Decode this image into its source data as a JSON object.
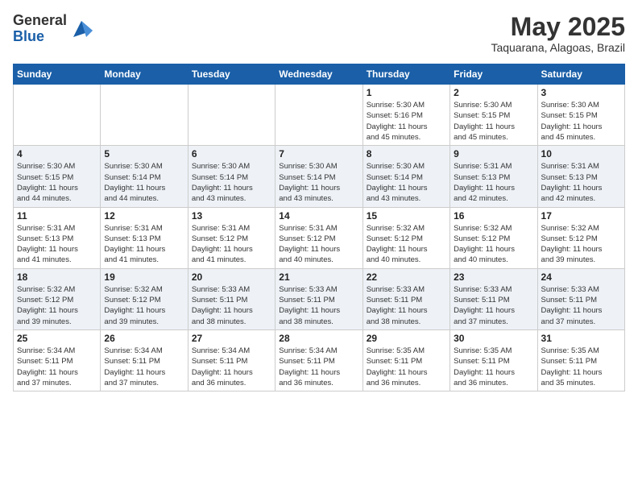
{
  "header": {
    "logo_general": "General",
    "logo_blue": "Blue",
    "month_title": "May 2025",
    "location": "Taquarana, Alagoas, Brazil"
  },
  "weekdays": [
    "Sunday",
    "Monday",
    "Tuesday",
    "Wednesday",
    "Thursday",
    "Friday",
    "Saturday"
  ],
  "weeks": [
    [
      {
        "day": "",
        "info": ""
      },
      {
        "day": "",
        "info": ""
      },
      {
        "day": "",
        "info": ""
      },
      {
        "day": "",
        "info": ""
      },
      {
        "day": "1",
        "info": "Sunrise: 5:30 AM\nSunset: 5:16 PM\nDaylight: 11 hours\nand 45 minutes."
      },
      {
        "day": "2",
        "info": "Sunrise: 5:30 AM\nSunset: 5:15 PM\nDaylight: 11 hours\nand 45 minutes."
      },
      {
        "day": "3",
        "info": "Sunrise: 5:30 AM\nSunset: 5:15 PM\nDaylight: 11 hours\nand 45 minutes."
      }
    ],
    [
      {
        "day": "4",
        "info": "Sunrise: 5:30 AM\nSunset: 5:15 PM\nDaylight: 11 hours\nand 44 minutes."
      },
      {
        "day": "5",
        "info": "Sunrise: 5:30 AM\nSunset: 5:14 PM\nDaylight: 11 hours\nand 44 minutes."
      },
      {
        "day": "6",
        "info": "Sunrise: 5:30 AM\nSunset: 5:14 PM\nDaylight: 11 hours\nand 43 minutes."
      },
      {
        "day": "7",
        "info": "Sunrise: 5:30 AM\nSunset: 5:14 PM\nDaylight: 11 hours\nand 43 minutes."
      },
      {
        "day": "8",
        "info": "Sunrise: 5:30 AM\nSunset: 5:14 PM\nDaylight: 11 hours\nand 43 minutes."
      },
      {
        "day": "9",
        "info": "Sunrise: 5:31 AM\nSunset: 5:13 PM\nDaylight: 11 hours\nand 42 minutes."
      },
      {
        "day": "10",
        "info": "Sunrise: 5:31 AM\nSunset: 5:13 PM\nDaylight: 11 hours\nand 42 minutes."
      }
    ],
    [
      {
        "day": "11",
        "info": "Sunrise: 5:31 AM\nSunset: 5:13 PM\nDaylight: 11 hours\nand 41 minutes."
      },
      {
        "day": "12",
        "info": "Sunrise: 5:31 AM\nSunset: 5:13 PM\nDaylight: 11 hours\nand 41 minutes."
      },
      {
        "day": "13",
        "info": "Sunrise: 5:31 AM\nSunset: 5:12 PM\nDaylight: 11 hours\nand 41 minutes."
      },
      {
        "day": "14",
        "info": "Sunrise: 5:31 AM\nSunset: 5:12 PM\nDaylight: 11 hours\nand 40 minutes."
      },
      {
        "day": "15",
        "info": "Sunrise: 5:32 AM\nSunset: 5:12 PM\nDaylight: 11 hours\nand 40 minutes."
      },
      {
        "day": "16",
        "info": "Sunrise: 5:32 AM\nSunset: 5:12 PM\nDaylight: 11 hours\nand 40 minutes."
      },
      {
        "day": "17",
        "info": "Sunrise: 5:32 AM\nSunset: 5:12 PM\nDaylight: 11 hours\nand 39 minutes."
      }
    ],
    [
      {
        "day": "18",
        "info": "Sunrise: 5:32 AM\nSunset: 5:12 PM\nDaylight: 11 hours\nand 39 minutes."
      },
      {
        "day": "19",
        "info": "Sunrise: 5:32 AM\nSunset: 5:12 PM\nDaylight: 11 hours\nand 39 minutes."
      },
      {
        "day": "20",
        "info": "Sunrise: 5:33 AM\nSunset: 5:11 PM\nDaylight: 11 hours\nand 38 minutes."
      },
      {
        "day": "21",
        "info": "Sunrise: 5:33 AM\nSunset: 5:11 PM\nDaylight: 11 hours\nand 38 minutes."
      },
      {
        "day": "22",
        "info": "Sunrise: 5:33 AM\nSunset: 5:11 PM\nDaylight: 11 hours\nand 38 minutes."
      },
      {
        "day": "23",
        "info": "Sunrise: 5:33 AM\nSunset: 5:11 PM\nDaylight: 11 hours\nand 37 minutes."
      },
      {
        "day": "24",
        "info": "Sunrise: 5:33 AM\nSunset: 5:11 PM\nDaylight: 11 hours\nand 37 minutes."
      }
    ],
    [
      {
        "day": "25",
        "info": "Sunrise: 5:34 AM\nSunset: 5:11 PM\nDaylight: 11 hours\nand 37 minutes."
      },
      {
        "day": "26",
        "info": "Sunrise: 5:34 AM\nSunset: 5:11 PM\nDaylight: 11 hours\nand 37 minutes."
      },
      {
        "day": "27",
        "info": "Sunrise: 5:34 AM\nSunset: 5:11 PM\nDaylight: 11 hours\nand 36 minutes."
      },
      {
        "day": "28",
        "info": "Sunrise: 5:34 AM\nSunset: 5:11 PM\nDaylight: 11 hours\nand 36 minutes."
      },
      {
        "day": "29",
        "info": "Sunrise: 5:35 AM\nSunset: 5:11 PM\nDaylight: 11 hours\nand 36 minutes."
      },
      {
        "day": "30",
        "info": "Sunrise: 5:35 AM\nSunset: 5:11 PM\nDaylight: 11 hours\nand 36 minutes."
      },
      {
        "day": "31",
        "info": "Sunrise: 5:35 AM\nSunset: 5:11 PM\nDaylight: 11 hours\nand 35 minutes."
      }
    ]
  ]
}
